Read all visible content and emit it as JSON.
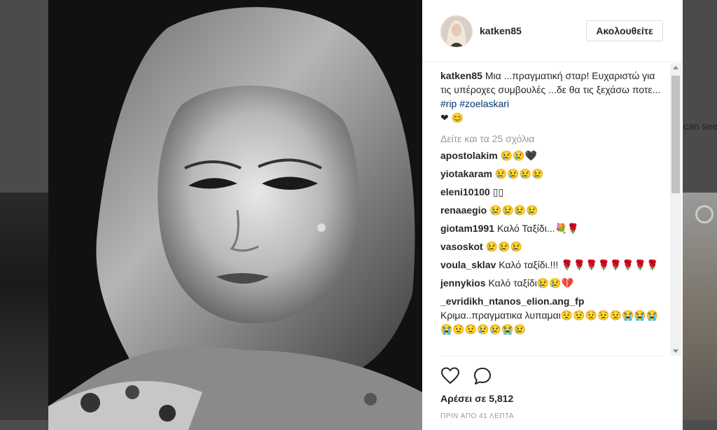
{
  "background": {
    "partial_text": "can see"
  },
  "post": {
    "username": "katken85",
    "follow_label": "Ακολουθείτε",
    "caption": {
      "username": "katken85",
      "text": "Μια ...πραγματική σταρ! Ευχαριστώ για τις υπέροχες συμβουλές ...δε θα τις ξεχάσω ποτε... ",
      "hashtags": [
        "#rip",
        "#zoelaskari"
      ],
      "emojis": "❤ 😊"
    },
    "view_all_comments": "Δείτε και τα 25 σχόλια",
    "comments": [
      {
        "user": "apostolakim",
        "text": "😢😢🖤"
      },
      {
        "user": "yiotakaram",
        "text": "😢😢😢😢"
      },
      {
        "user": "eleni10100",
        "text": "▯▯"
      },
      {
        "user": "renaaegio",
        "text": "😢😢😢😢"
      },
      {
        "user": "giotam1991",
        "text": "Καλό Ταξίδι...💐🌹"
      },
      {
        "user": "vasoskot",
        "text": "😢😢😢"
      },
      {
        "user": "voula_sklav",
        "text": "Καλό ταξίδι.!!! 🌹🌹🌹🌹🌹🌹🌹🌹"
      },
      {
        "user": "jennykios",
        "text": "Καλό ταξίδι😢😢💔"
      },
      {
        "user": "_evridikh_ntanos_elion.ang_fp",
        "text": "Κριμα..πραγματικα λυπαμαι😟😟😟😟😟😭😭😭😭😟😟😢😢😭😢"
      }
    ],
    "likes": "Αρέσει σε 5,812",
    "timestamp": "ΠΡΙΝ ΑΠΟ 41 ΛΕΠΤΑ"
  },
  "icons": {
    "like": "heart-icon",
    "comment": "comment-bubble-icon",
    "scroll_up": "arrow-up-icon",
    "scroll_down": "arrow-down-icon"
  },
  "colors": {
    "hashtag": "#003569",
    "muted": "#999999",
    "text": "#262626"
  }
}
